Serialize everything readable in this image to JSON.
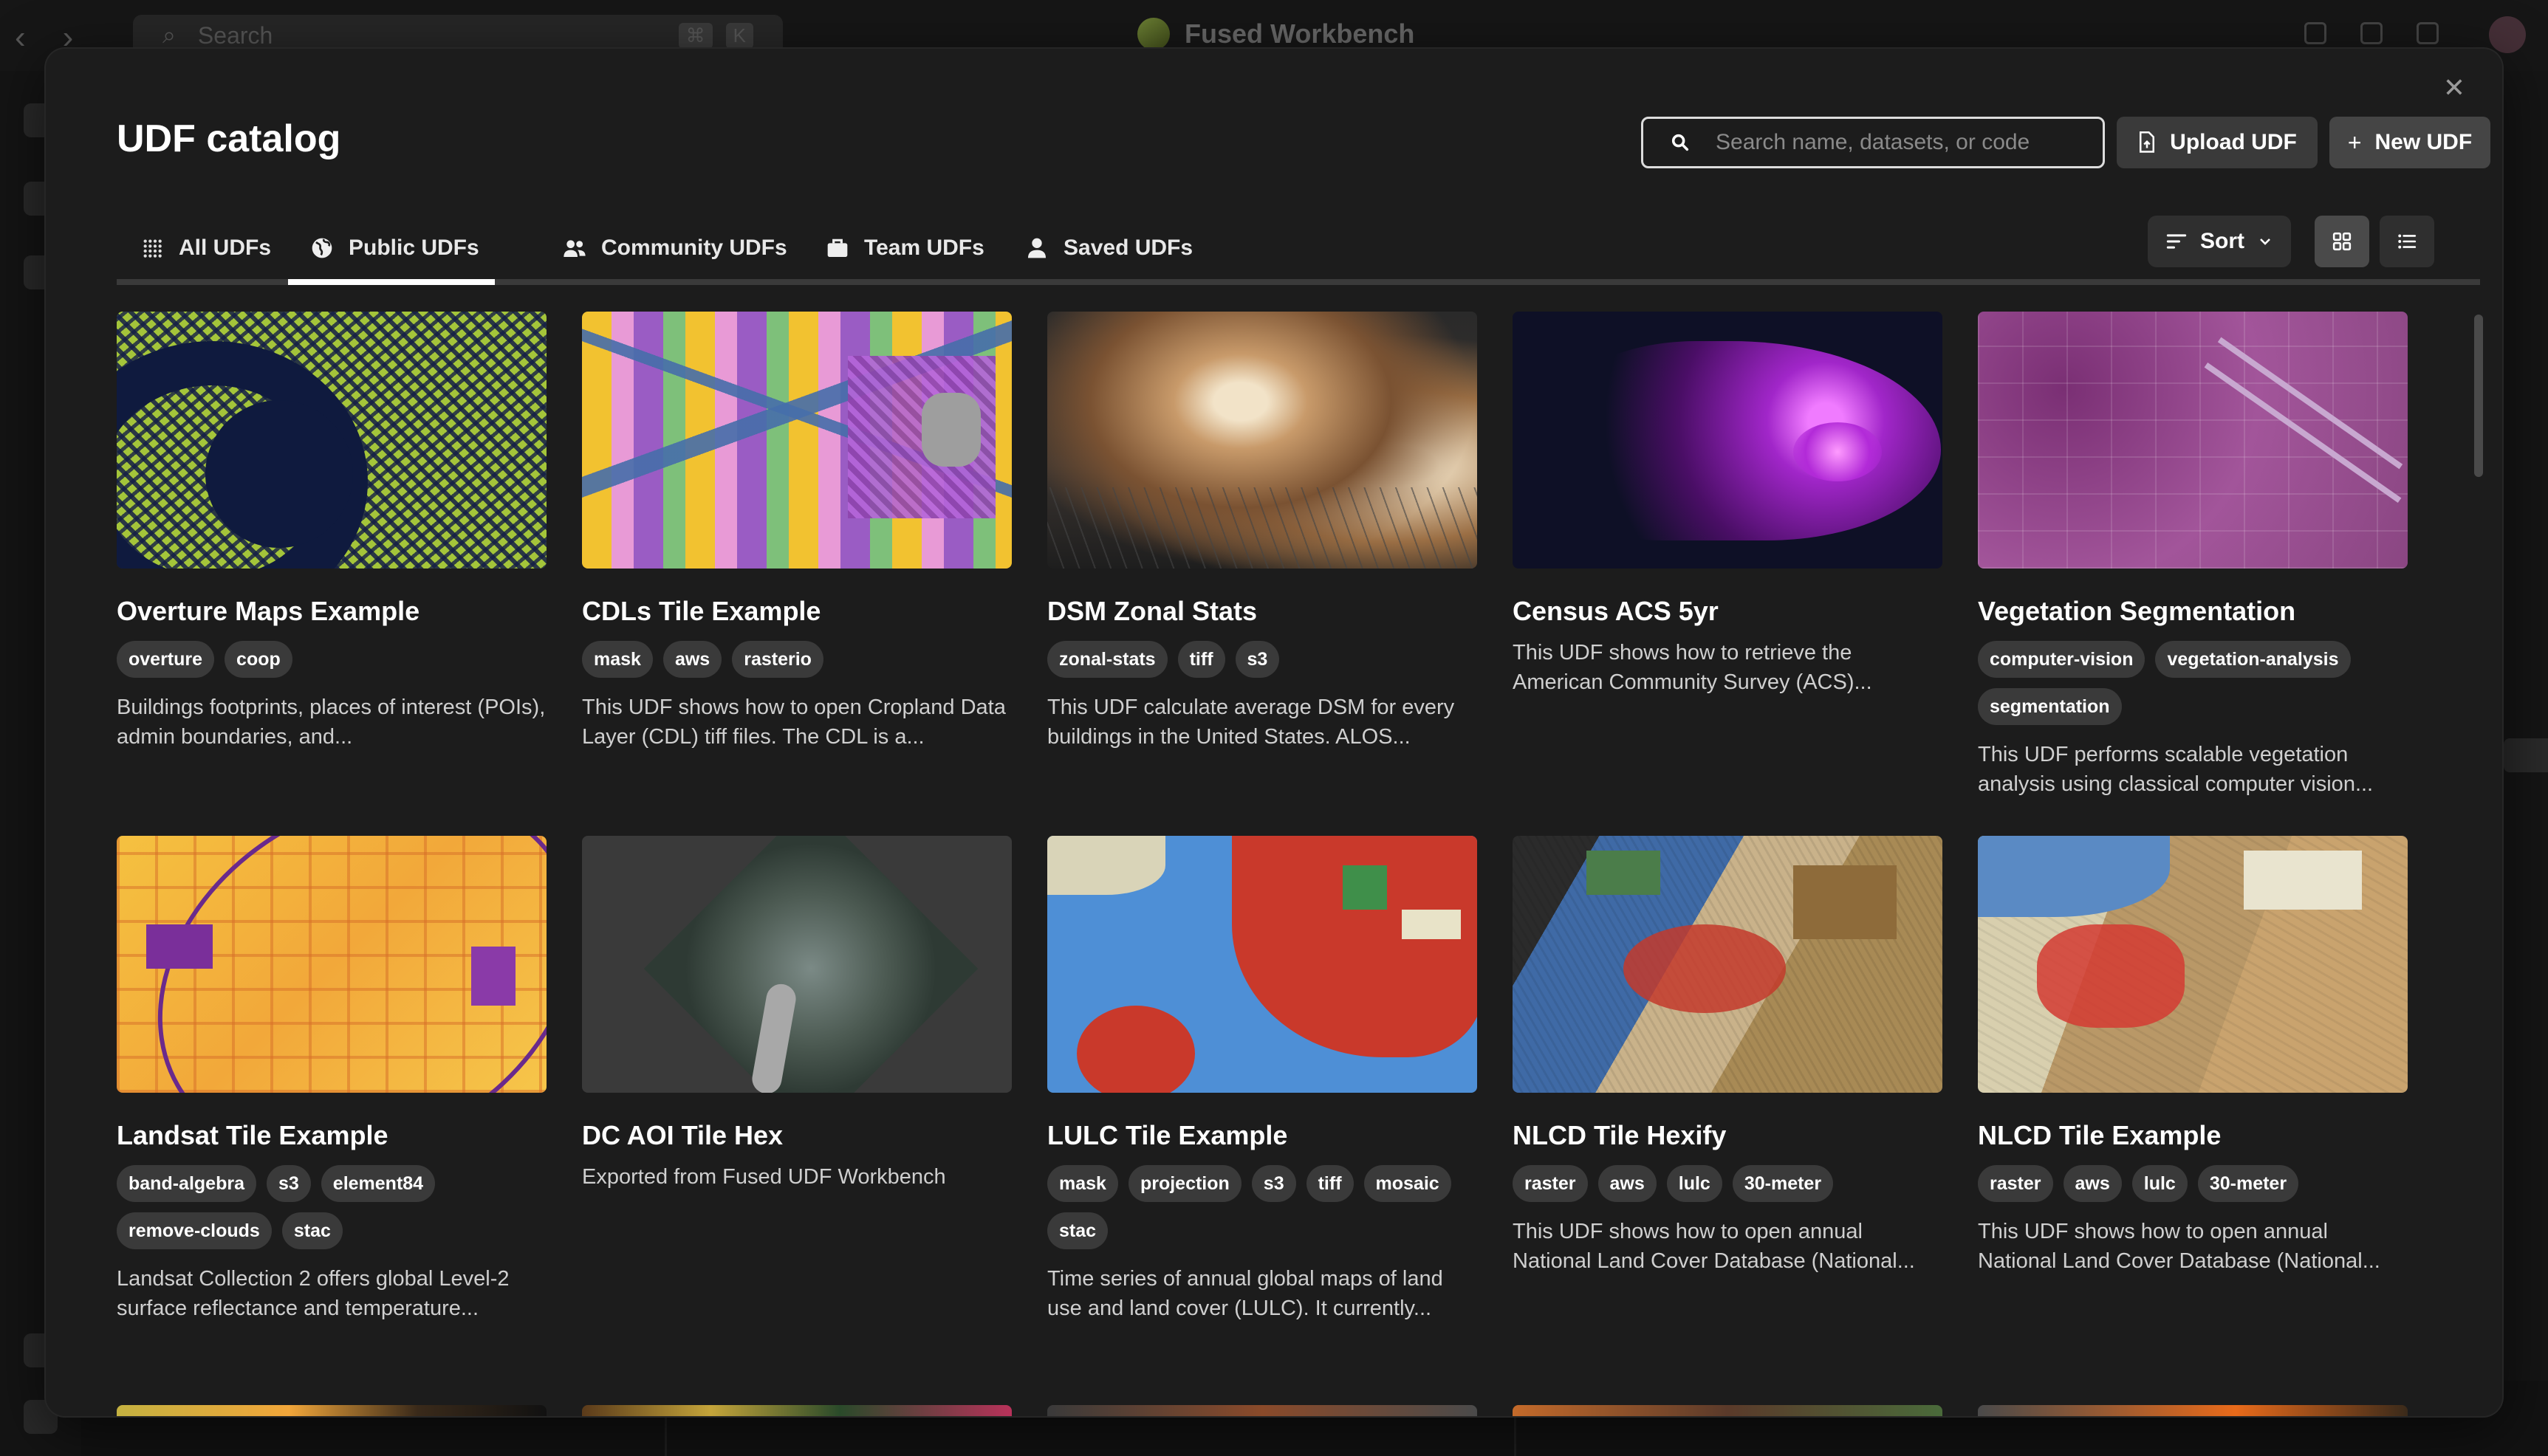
{
  "background": {
    "search_placeholder": "Search",
    "search_kbd": [
      "⌘",
      "K"
    ],
    "app_title": "Fused Workbench"
  },
  "modal": {
    "title": "UDF catalog",
    "search_placeholder": "Search name, datasets, or code",
    "upload_label": "Upload UDF",
    "new_label": "New UDF",
    "sort_label": "Sort",
    "active_tab": "Public UDFs"
  },
  "tabs": [
    {
      "label": "All UDFs",
      "icon": "grid-dots-icon"
    },
    {
      "label": "Public UDFs",
      "icon": "globe-icon"
    },
    {
      "label": "Community UDFs",
      "icon": "users-icon"
    },
    {
      "label": "Team UDFs",
      "icon": "briefcase-icon"
    },
    {
      "label": "Saved UDFs",
      "icon": "user-icon"
    }
  ],
  "cards": [
    {
      "title": "Overture Maps Example",
      "tags": [
        "overture",
        "coop"
      ],
      "desc": "Buildings footprints, places of interest (POIs), admin boundaries, and..."
    },
    {
      "title": "CDLs Tile Example",
      "tags": [
        "mask",
        "aws",
        "rasterio"
      ],
      "desc": "This UDF shows how to open Cropland Data Layer (CDL) tiff files. The CDL is a..."
    },
    {
      "title": "DSM Zonal Stats",
      "tags": [
        "zonal-stats",
        "tiff",
        "s3"
      ],
      "desc": "This UDF calculate average DSM for every buildings in the United States. ALOS..."
    },
    {
      "title": "Census ACS 5yr",
      "tags": [],
      "desc": "This UDF shows how to retrieve the American Community Survey (ACS)..."
    },
    {
      "title": "Vegetation Segmentation",
      "tags": [
        "computer-vision",
        "vegetation-analysis",
        "segmentation"
      ],
      "desc": "This UDF performs scalable vegetation analysis using classical computer vision..."
    },
    {
      "title": "Landsat Tile Example",
      "tags": [
        "band-algebra",
        "s3",
        "element84",
        "remove-clouds",
        "stac"
      ],
      "desc": "Landsat Collection 2 offers global Level-2 surface reflectance and temperature..."
    },
    {
      "title": "DC AOI Tile Hex",
      "tags": [],
      "desc": "Exported from Fused UDF Workbench"
    },
    {
      "title": "LULC Tile Example",
      "tags": [
        "mask",
        "projection",
        "s3",
        "tiff",
        "mosaic",
        "stac"
      ],
      "desc": "Time series of annual global maps of land use and land cover (LULC). It currently..."
    },
    {
      "title": "NLCD Tile Hexify",
      "tags": [
        "raster",
        "aws",
        "lulc",
        "30-meter"
      ],
      "desc": "This UDF shows how to open annual National Land Cover Database (National..."
    },
    {
      "title": "NLCD Tile Example",
      "tags": [
        "raster",
        "aws",
        "lulc",
        "30-meter"
      ],
      "desc": "This UDF shows how to open annual National Land Cover Database (National..."
    }
  ]
}
